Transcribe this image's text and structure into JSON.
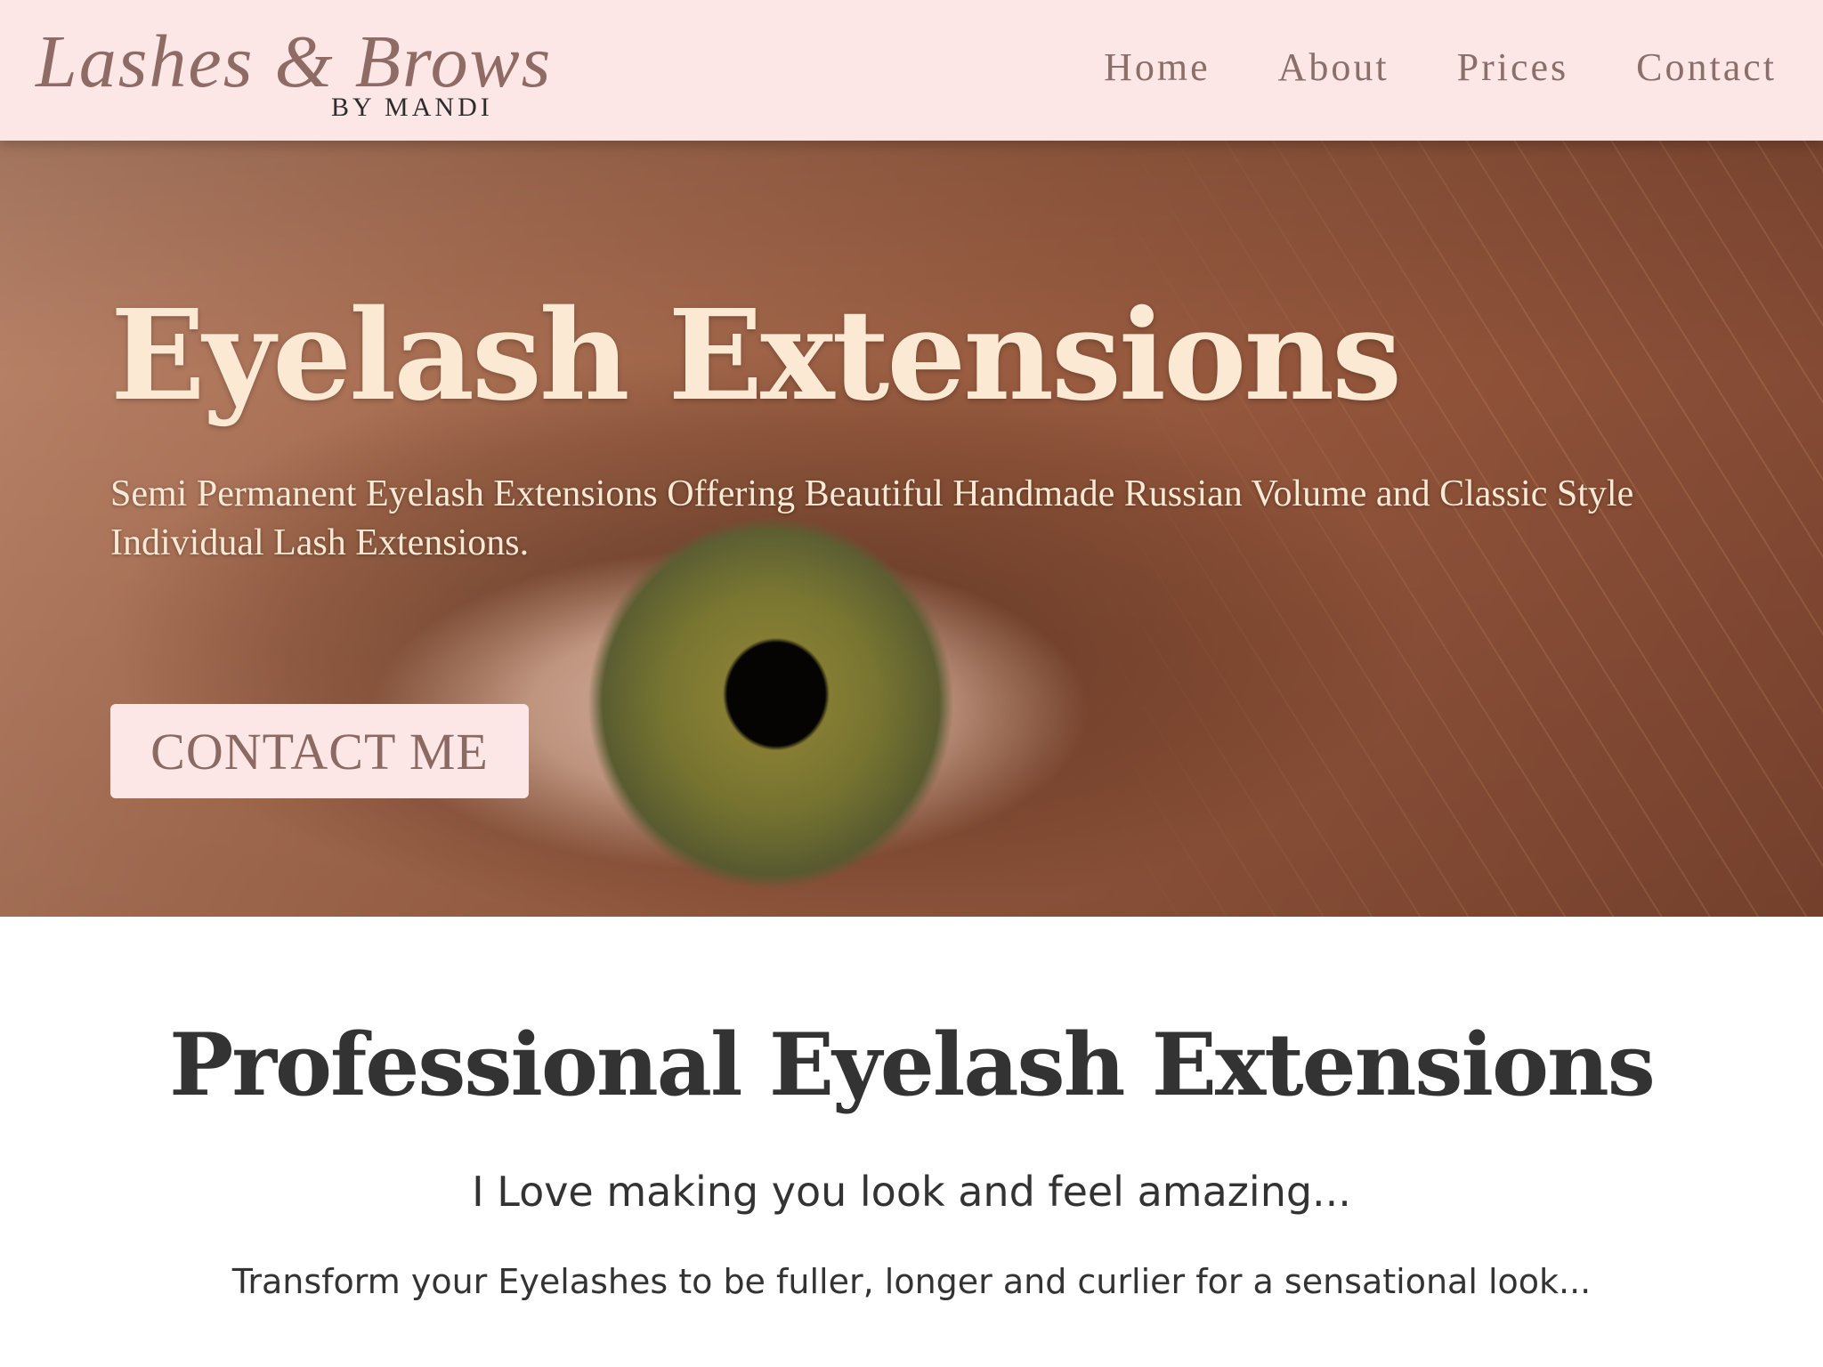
{
  "header": {
    "logo_script": "Lashes & Brows",
    "logo_sub": "BY MANDI",
    "nav": [
      {
        "label": "Home"
      },
      {
        "label": "About"
      },
      {
        "label": "Prices"
      },
      {
        "label": "Contact"
      }
    ]
  },
  "hero": {
    "title": "Eyelash Extensions",
    "subtitle": "Semi Permanent Eyelash Extensions Offering Beautiful Handmade Russian Volume and Classic Style Individual Lash Extensions.",
    "button_label": "CONTACT ME",
    "image": "eye-close-up-photo"
  },
  "content": {
    "title": "Professional Eyelash Extensions",
    "tagline": "I Love making you look and feel amazing...",
    "body": "Transform your Eyelashes to be fuller, longer and curlier for a sensational look..."
  },
  "colors": {
    "header_bg": "#fce6e6",
    "nav_text": "#8a6f6a",
    "hero_text": "#fbe9d4",
    "button_bg": "#fce6e6",
    "button_text": "#8a6a62",
    "body_text": "#333333"
  }
}
